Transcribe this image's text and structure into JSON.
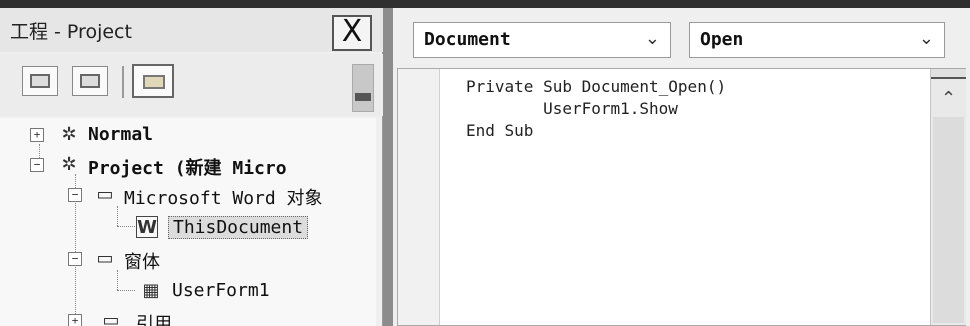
{
  "project_pane": {
    "title": "工程 - Project",
    "close_label": "X",
    "toolbar": {
      "view_code_icon": "view-code-icon",
      "view_object_icon": "view-object-icon",
      "toggle_folders_icon": "folder-icon"
    },
    "tree": [
      {
        "expander": "+",
        "icon": "project-icon",
        "glyph": "✲",
        "label": "Normal",
        "bold": true
      },
      {
        "expander": "−",
        "icon": "project-icon",
        "glyph": "✲",
        "label": "Project (新建 Micro",
        "bold": true
      },
      {
        "expander": "−",
        "icon": "folder-icon",
        "glyph": "▭",
        "label": "Microsoft Word 对象",
        "bold": false
      },
      {
        "expander": "",
        "icon": "document-icon",
        "glyph": "W",
        "label": "ThisDocument",
        "bold": false,
        "selected": true
      },
      {
        "expander": "−",
        "icon": "folder-icon",
        "glyph": "▭",
        "label": "窗体",
        "bold": false
      },
      {
        "expander": "",
        "icon": "form-icon",
        "glyph": "▦",
        "label": "UserForm1",
        "bold": false
      },
      {
        "expander": "+",
        "icon": "folder-icon",
        "glyph": "▭",
        "label": "引用",
        "bold": false
      }
    ]
  },
  "code_window": {
    "object_combo": "Document",
    "procedure_combo": "Open",
    "lines": [
      "Private Sub Document_Open()",
      "        UserForm1.Show",
      "End Sub"
    ]
  }
}
